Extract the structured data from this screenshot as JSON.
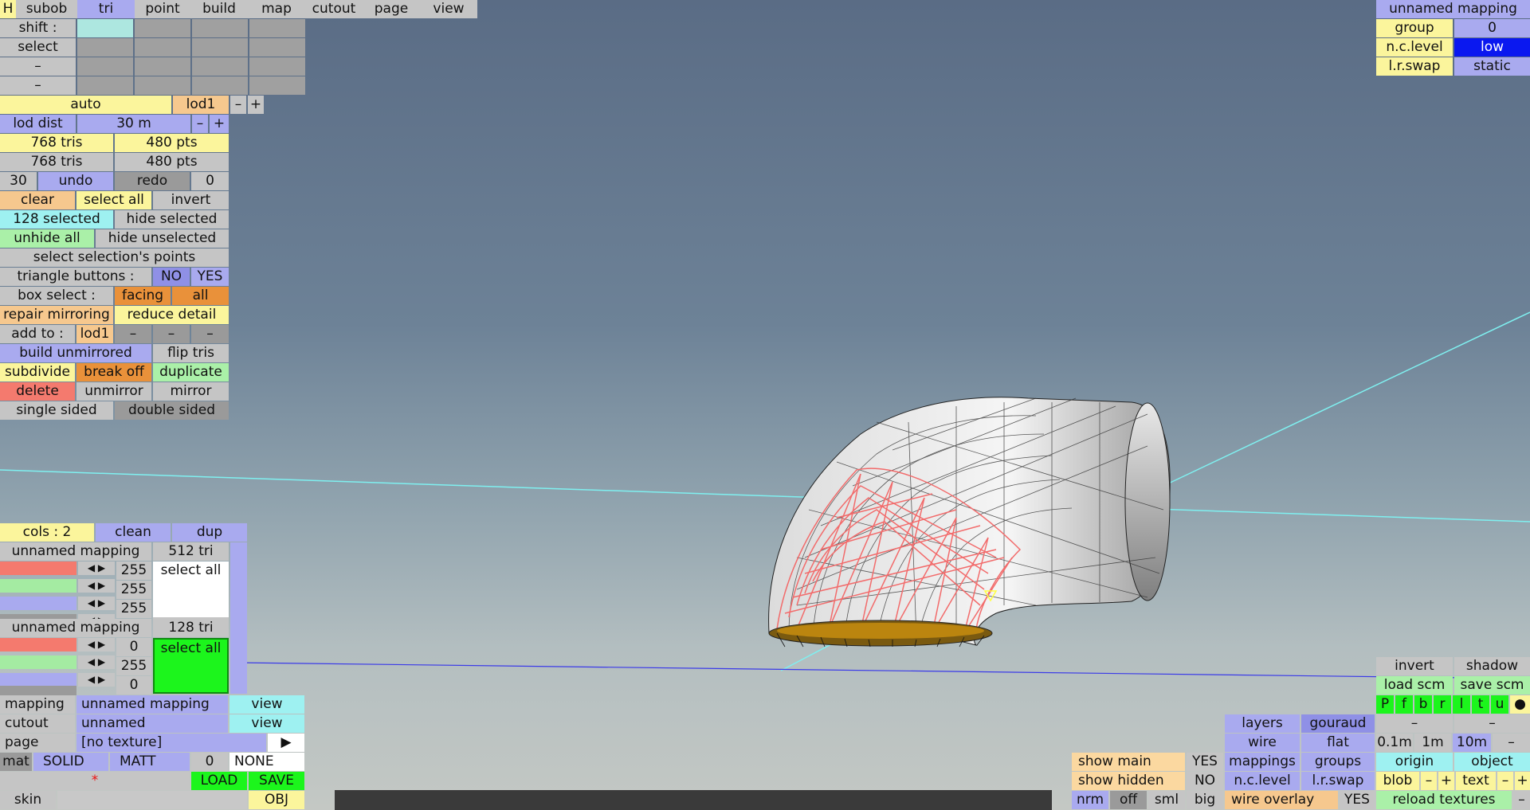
{
  "tabs": [
    "H",
    "subob",
    "tri",
    "point",
    "build",
    "map",
    "cutout",
    "page",
    "view"
  ],
  "tabs_selected": "tri",
  "left": {
    "shift": "shift :",
    "select": "select",
    "dash": "–",
    "auto": "auto",
    "lod1": "lod1",
    "minus": "–",
    "plus": "+",
    "lod_dist_label": "lod dist",
    "lod_dist_val": "30 m",
    "tris1": "768 tris",
    "pts1": "480 pts",
    "tris2": "768 tris",
    "pts2": "480 pts",
    "undo_count": "30",
    "undo": "undo",
    "redo": "redo",
    "redo_count": "0",
    "clear": "clear",
    "select_all": "select all",
    "invert": "invert",
    "selected": "128 selected",
    "hide_selected": "hide selected",
    "unhide_all": "unhide all",
    "hide_unselected": "hide unselected",
    "select_points": "select selection's points",
    "triangle_buttons": "triangle buttons :",
    "no": "NO",
    "yes": "YES",
    "box_select": "box select :",
    "facing": "facing",
    "all": "all",
    "repair_mirroring": "repair mirroring",
    "reduce_detail": "reduce detail",
    "add_to": "add to :",
    "add_lod1": "lod1",
    "build_unmirrored": "build unmirrored",
    "flip_tris": "flip tris",
    "subdivide": "subdivide",
    "break_off": "break off",
    "duplicate": "duplicate",
    "delete": "delete",
    "unmirror": "unmirror",
    "mirror": "mirror",
    "single_sided": "single sided",
    "double_sided": "double sided"
  },
  "mappings": {
    "cols": "cols : 2",
    "clean": "clean",
    "dup": "dup",
    "m1_name": "unnamed mapping",
    "m1_tris": "512 tri",
    "m1_r": "255",
    "m1_g": "255",
    "m1_b": "255",
    "m1_select": "select all",
    "m2_name": "unnamed mapping",
    "m2_tris": "128 tri",
    "m2_r": "0",
    "m2_g": "255",
    "m2_b": "0",
    "m2_select": "select all",
    "mapping_label": "mapping",
    "mapping_val": "unnamed mapping",
    "view": "view",
    "cutout_label": "cutout",
    "cutout_val": "unnamed",
    "page_label": "page",
    "page_val": "[no texture]",
    "mat": "mat",
    "solid": "SOLID",
    "matt": "MATT",
    "mat_num": "0",
    "none": "NONE",
    "star": "*",
    "load": "LOAD",
    "save": "SAVE",
    "skin": "skin",
    "obj": "OBJ",
    "colors": {
      "red": "#f47a6e",
      "green": "#a4eba2",
      "blue": "#a9aaef",
      "swatch2": "#1cf51c"
    }
  },
  "top_right": {
    "title": "unnamed mapping",
    "group": "group",
    "group_val": "0",
    "nclevel": "n.c.level",
    "nclevel_val": "low",
    "lrswap": "l.r.swap",
    "lrswap_val": "static"
  },
  "bottom_right": {
    "invert": "invert",
    "shadow": "shadow",
    "load_scm": "load scm",
    "save_scm": "save scm",
    "letters": [
      "P",
      "f",
      "b",
      "r",
      "l",
      "t",
      "u",
      "●"
    ],
    "layers": "layers",
    "gouraud": "gouraud",
    "dash": "–",
    "wire": "wire",
    "flat": "flat",
    "d01": "0.1m",
    "d1": "1m",
    "d10": "10m",
    "mappings": "mappings",
    "groups": "groups",
    "origin": "origin",
    "object": "object",
    "nclevel": "n.c.level",
    "lrswap": "l.r.swap",
    "blob": "blob",
    "minus": "–",
    "plus": "+",
    "text": "text",
    "show_main": "show main",
    "show_main_val": "YES",
    "show_hidden": "show hidden",
    "show_hidden_val": "NO",
    "nrm": "nrm",
    "off": "off",
    "sml": "sml",
    "big": "big",
    "wire_overlay": "wire overlay",
    "wire_overlay_val": "YES",
    "reload_textures": "reload textures"
  }
}
